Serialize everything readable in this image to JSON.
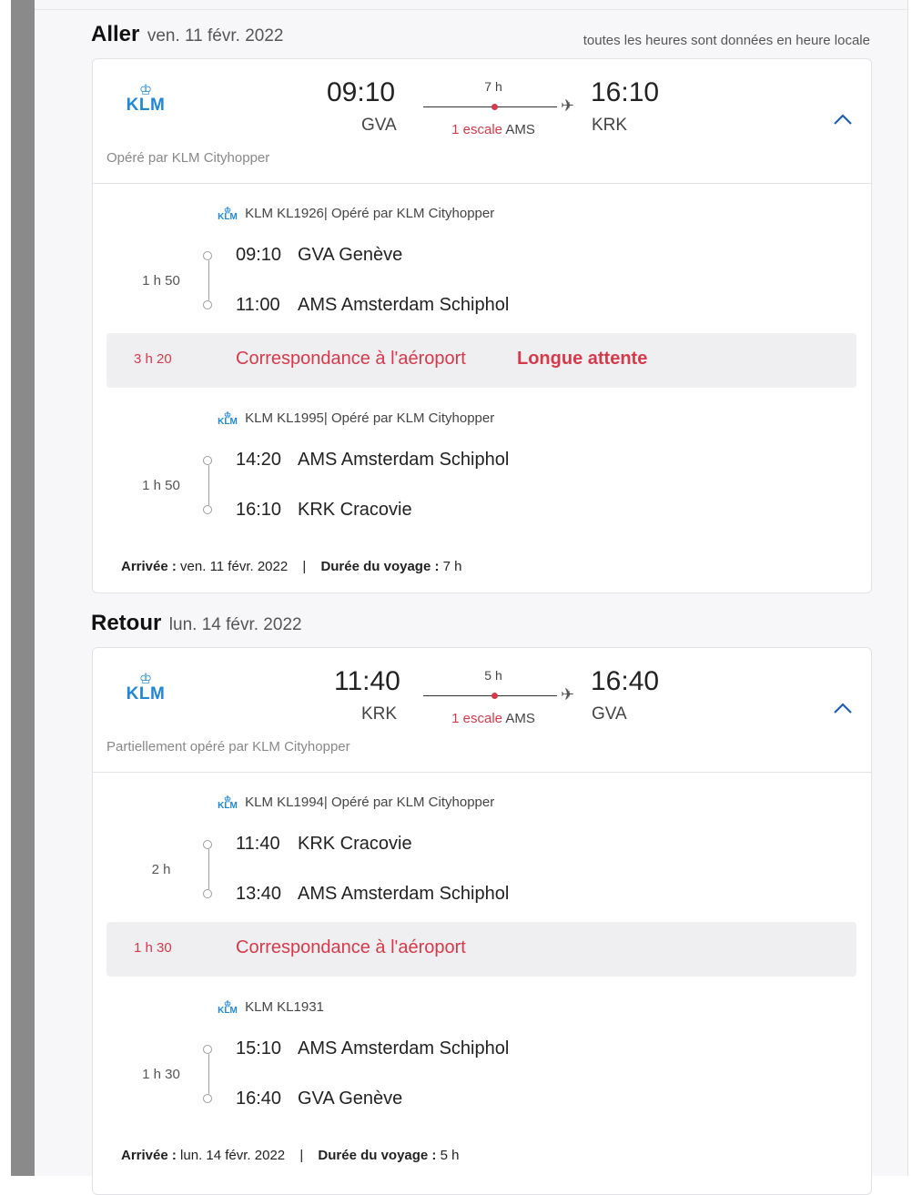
{
  "tz_note": "toutes les heures sont données en heure locale",
  "colors": {
    "accent": "#1f87d6",
    "alert": "#d63a4a"
  },
  "outbound": {
    "title": "Aller",
    "date": "ven. 11 févr. 2022",
    "airline_logo": "KLM",
    "dep_time": "09:10",
    "dep_code": "GVA",
    "arr_time": "16:10",
    "arr_code": "KRK",
    "duration": "7 h",
    "stops_count": "1 escale",
    "stops_airport": "AMS",
    "operated": "Opéré par KLM Cityhopper",
    "seg1": {
      "flight": "KLM KL1926| Opéré par KLM Cityhopper",
      "dur": "1 h 50",
      "from_time": "09:10",
      "from_place": "GVA Genève",
      "to_time": "11:00",
      "to_place": "AMS Amsterdam Schiphol"
    },
    "connection": {
      "dur": "3 h 20",
      "label": "Correspondance à l'aéroport",
      "warning": "Longue attente"
    },
    "seg2": {
      "flight": "KLM KL1995| Opéré par KLM Cityhopper",
      "dur": "1 h 50",
      "from_time": "14:20",
      "from_place": "AMS Amsterdam Schiphol",
      "to_time": "16:10",
      "to_place": "KRK Cracovie"
    },
    "arrival_label": "Arrivée :",
    "arrival_value": "ven. 11 févr. 2022",
    "sep": "|",
    "trip_label": "Durée du voyage :",
    "trip_value": "7 h"
  },
  "return": {
    "title": "Retour",
    "date": "lun. 14 févr. 2022",
    "airline_logo": "KLM",
    "dep_time": "11:40",
    "dep_code": "KRK",
    "arr_time": "16:40",
    "arr_code": "GVA",
    "duration": "5 h",
    "stops_count": "1 escale",
    "stops_airport": "AMS",
    "operated": "Partiellement opéré par KLM Cityhopper",
    "seg1": {
      "flight": "KLM KL1994| Opéré par KLM Cityhopper",
      "dur": "2 h",
      "from_time": "11:40",
      "from_place": "KRK Cracovie",
      "to_time": "13:40",
      "to_place": "AMS Amsterdam Schiphol"
    },
    "connection": {
      "dur": "1 h 30",
      "label": "Correspondance à l'aéroport"
    },
    "seg2": {
      "flight": "KLM KL1931",
      "dur": "1 h 30",
      "from_time": "15:10",
      "from_place": "AMS Amsterdam Schiphol",
      "to_time": "16:40",
      "to_place": "GVA Genève"
    },
    "arrival_label": "Arrivée :",
    "arrival_value": "lun. 14 févr. 2022",
    "sep": "|",
    "trip_label": "Durée du voyage :",
    "trip_value": "5 h"
  }
}
